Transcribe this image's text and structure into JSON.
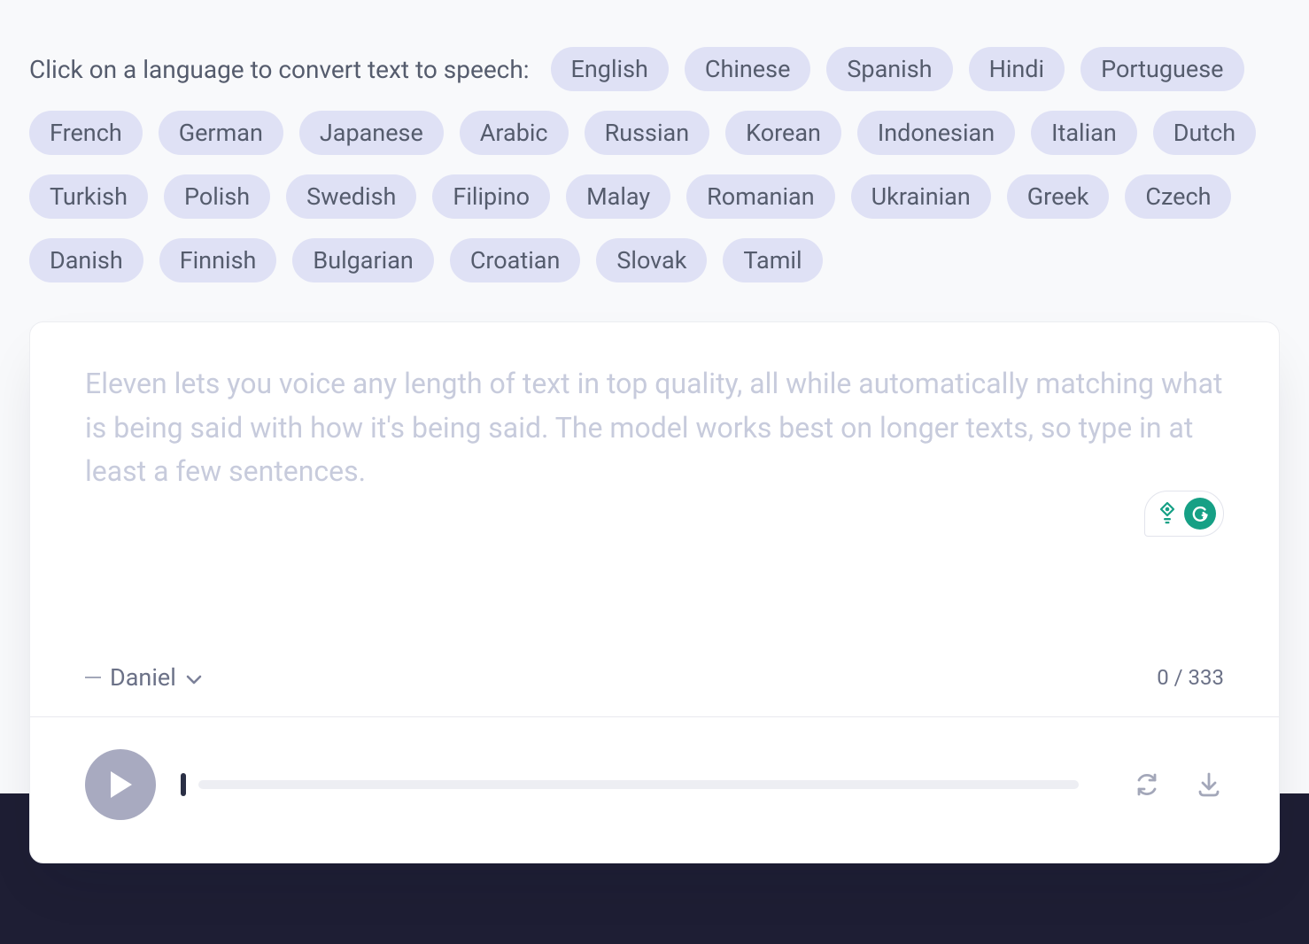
{
  "prompt": "Click on a language to convert text to speech:",
  "languages": [
    "English",
    "Chinese",
    "Spanish",
    "Hindi",
    "Portuguese",
    "French",
    "German",
    "Japanese",
    "Arabic",
    "Russian",
    "Korean",
    "Indonesian",
    "Italian",
    "Dutch",
    "Turkish",
    "Polish",
    "Swedish",
    "Filipino",
    "Malay",
    "Romanian",
    "Ukrainian",
    "Greek",
    "Czech",
    "Danish",
    "Finnish",
    "Bulgarian",
    "Croatian",
    "Slovak",
    "Tamil"
  ],
  "editor": {
    "placeholder": "Eleven lets you voice any length of text in top quality, all while automatically matching what is being said with how it's being said. The model works best on longer texts, so type in at least a few sentences.",
    "value": ""
  },
  "voice": {
    "selected": "Daniel"
  },
  "counter": {
    "current": 0,
    "max": 333,
    "display": "0 / 333"
  },
  "colors": {
    "chip_bg": "#DFE1F5",
    "page_bg": "#F8F9FB",
    "dark_strip": "#1E1E34",
    "play_btn": "#A8AAC0",
    "grammarly": "#16A085"
  }
}
